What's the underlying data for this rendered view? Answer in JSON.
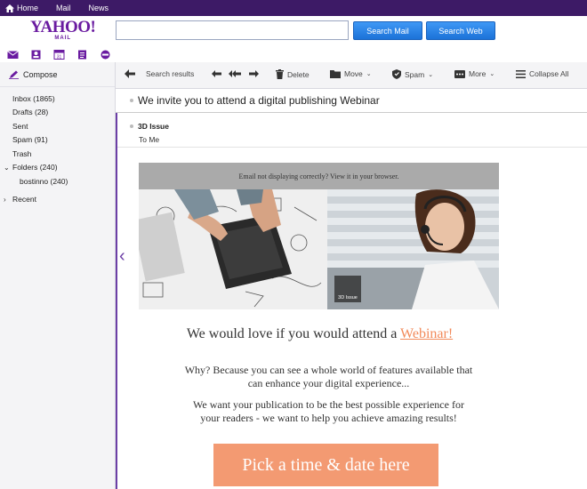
{
  "topbar": {
    "items": [
      "Home",
      "Mail",
      "News"
    ]
  },
  "logo": {
    "brand": "YAHOO!",
    "sub": "MAIL"
  },
  "search": {
    "value": "",
    "mail_button": "Search Mail",
    "web_button": "Search Web"
  },
  "sidebar": {
    "compose": "Compose",
    "folders": [
      {
        "label": "Inbox (1865)"
      },
      {
        "label": "Drafts (28)"
      },
      {
        "label": "Sent"
      },
      {
        "label": "Spam (91)"
      },
      {
        "label": "Trash"
      }
    ],
    "folders_group": "Folders (240)",
    "subfolder": "bostinno  (240)",
    "recent": "Recent"
  },
  "toolbar": {
    "search_results": "Search results",
    "delete": "Delete",
    "move": "Move",
    "spam": "Spam",
    "more": "More",
    "collapse": "Collapse All"
  },
  "message": {
    "subject": "We invite you to attend a digital publishing Webinar",
    "sender": "3D Issue",
    "to": "To  Me",
    "banner_notice": "Email not displaying correctly? View it in your browser.",
    "badge": "3D Issue",
    "headline_text": "We would love if you would attend a ",
    "headline_link": "Webinar!",
    "para1_line1": "Why? Because you can see a whole world of features available that",
    "para1_line2": "can enhance your digital experience...",
    "para2_line1": "We want your publication to be the best possible experience for",
    "para2_line2": "your readers - we want to help you achieve amazing results!",
    "cta": "Pick a time & date here"
  },
  "colors": {
    "topbar": "#3d1a66",
    "brand": "#6a1ba0",
    "accent_link": "#f28a5a",
    "cta": "#f39a72",
    "button_blue": "#1b72d8"
  }
}
